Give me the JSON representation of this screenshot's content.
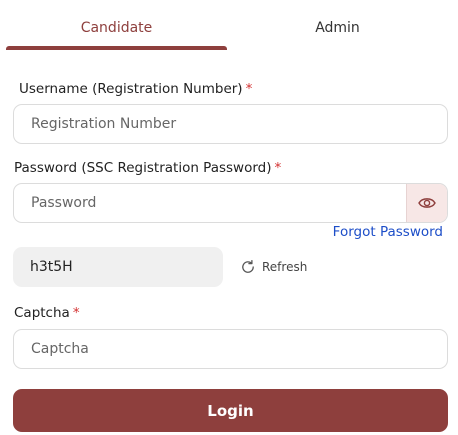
{
  "tabs": [
    {
      "label": "Candidate",
      "active": true
    },
    {
      "label": "Admin",
      "active": false
    }
  ],
  "username": {
    "label": "Username (Registration Number)",
    "required_mark": "*",
    "placeholder": "Registration Number",
    "value": ""
  },
  "password": {
    "label": "Password (SSC Registration Password)",
    "required_mark": "*",
    "placeholder": "Password",
    "value": "",
    "toggle_icon": "eye-icon"
  },
  "forgot_password": "Forgot Password",
  "captcha_image_text": "h3t5H",
  "refresh_label": "Refresh",
  "captcha": {
    "label": "Captcha",
    "required_mark": "*",
    "placeholder": "Captcha",
    "value": ""
  },
  "login_label": "Login",
  "colors": {
    "accent": "#8e3f3d",
    "link": "#1d4ec8",
    "required": "#d32f2f"
  }
}
